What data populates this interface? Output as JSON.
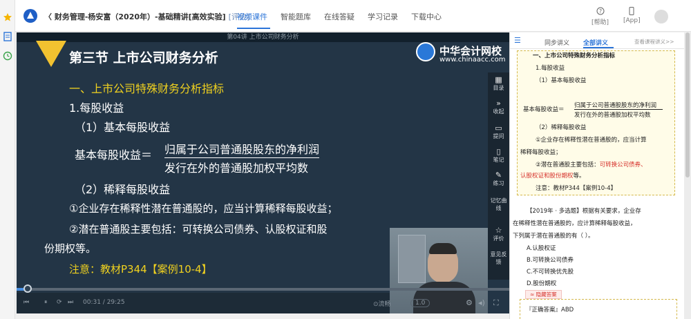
{
  "top": {
    "course_title": "财务管理-杨安富（2020年）-基础精讲[高效实验]",
    "eval": "[评价]",
    "nav": [
      "视频课件",
      "智能题库",
      "在线答疑",
      "学习记录",
      "下载中心"
    ],
    "help": "[帮助]",
    "app": "[App]"
  },
  "player": {
    "header": "第04讲   上市公司财务分析",
    "section_title": "第三节    上市公司财务分析",
    "brand_cn": "中华会计网校",
    "brand_url": "www.chinaacc.com",
    "lines": {
      "l1": "一、上市公司特殊财务分析指标",
      "l2": "1.每股收益",
      "l3": "（1）基本每股收益",
      "l4_label": "基本每股收益＝",
      "num": "归属于公司普通股股东的净利润",
      "den": "发行在外的普通股加权平均数",
      "l5": "（2）稀释每股收益",
      "l6": "①企业存在稀释性潜在普通股的，应当计算稀释每股收益；",
      "l7": "②潜在普通股主要包括：可转换公司债券、认股权证和股",
      "l8": "份期权等。",
      "l9": "注意：教材P344【案例10-4】"
    },
    "tools": [
      "目录",
      "收起",
      "提问",
      "笔记",
      "练习",
      "记忆曲线",
      "评价",
      "意见反馈"
    ],
    "time": "00:31 / 29:25",
    "progress": 0.02,
    "speed_label": "⊙流畅",
    "speed": "1.0"
  },
  "right": {
    "tab1": "同步讲义",
    "tab2": "全部讲义",
    "tab3": "查看课程讲义>>",
    "note": {
      "n1": "一、上市公司特殊财务分析指标",
      "n2": "1.每股收益",
      "n3": "（1）基本每股收益",
      "n4_label": "基本每股收益＝",
      "n4_num": "归属于公司普通股股东的净利润",
      "n4_den": "发行在外的普通股加权平均数",
      "n5": "（2）稀释每股收益",
      "n6a": "①企业存在稀释性潜在普通股的，应当计算",
      "n6b": "稀释每股收益；",
      "n7a": "②潜在普通股主要包括：",
      "n7b": "可转换公司债券、",
      "n7c": "认股权证和股份期权",
      "n7d": "等。",
      "n8": "注意：教材P344【案例10-4】"
    },
    "question": {
      "q1": "【2019年 · 多选题】根据有关要求，企业存",
      "q2": "在稀释性潜在普通股的，应计算稀释每股收益，",
      "q3": "下列属于潜在普通股的有（   ）。",
      "a": "A.认股权证",
      "b": "B.可转换公司债券",
      "c": "C.不可转换优先股",
      "d": "D.股份期权",
      "hide": "隐藏答案",
      "answer": "『正确答案』ABD"
    }
  }
}
